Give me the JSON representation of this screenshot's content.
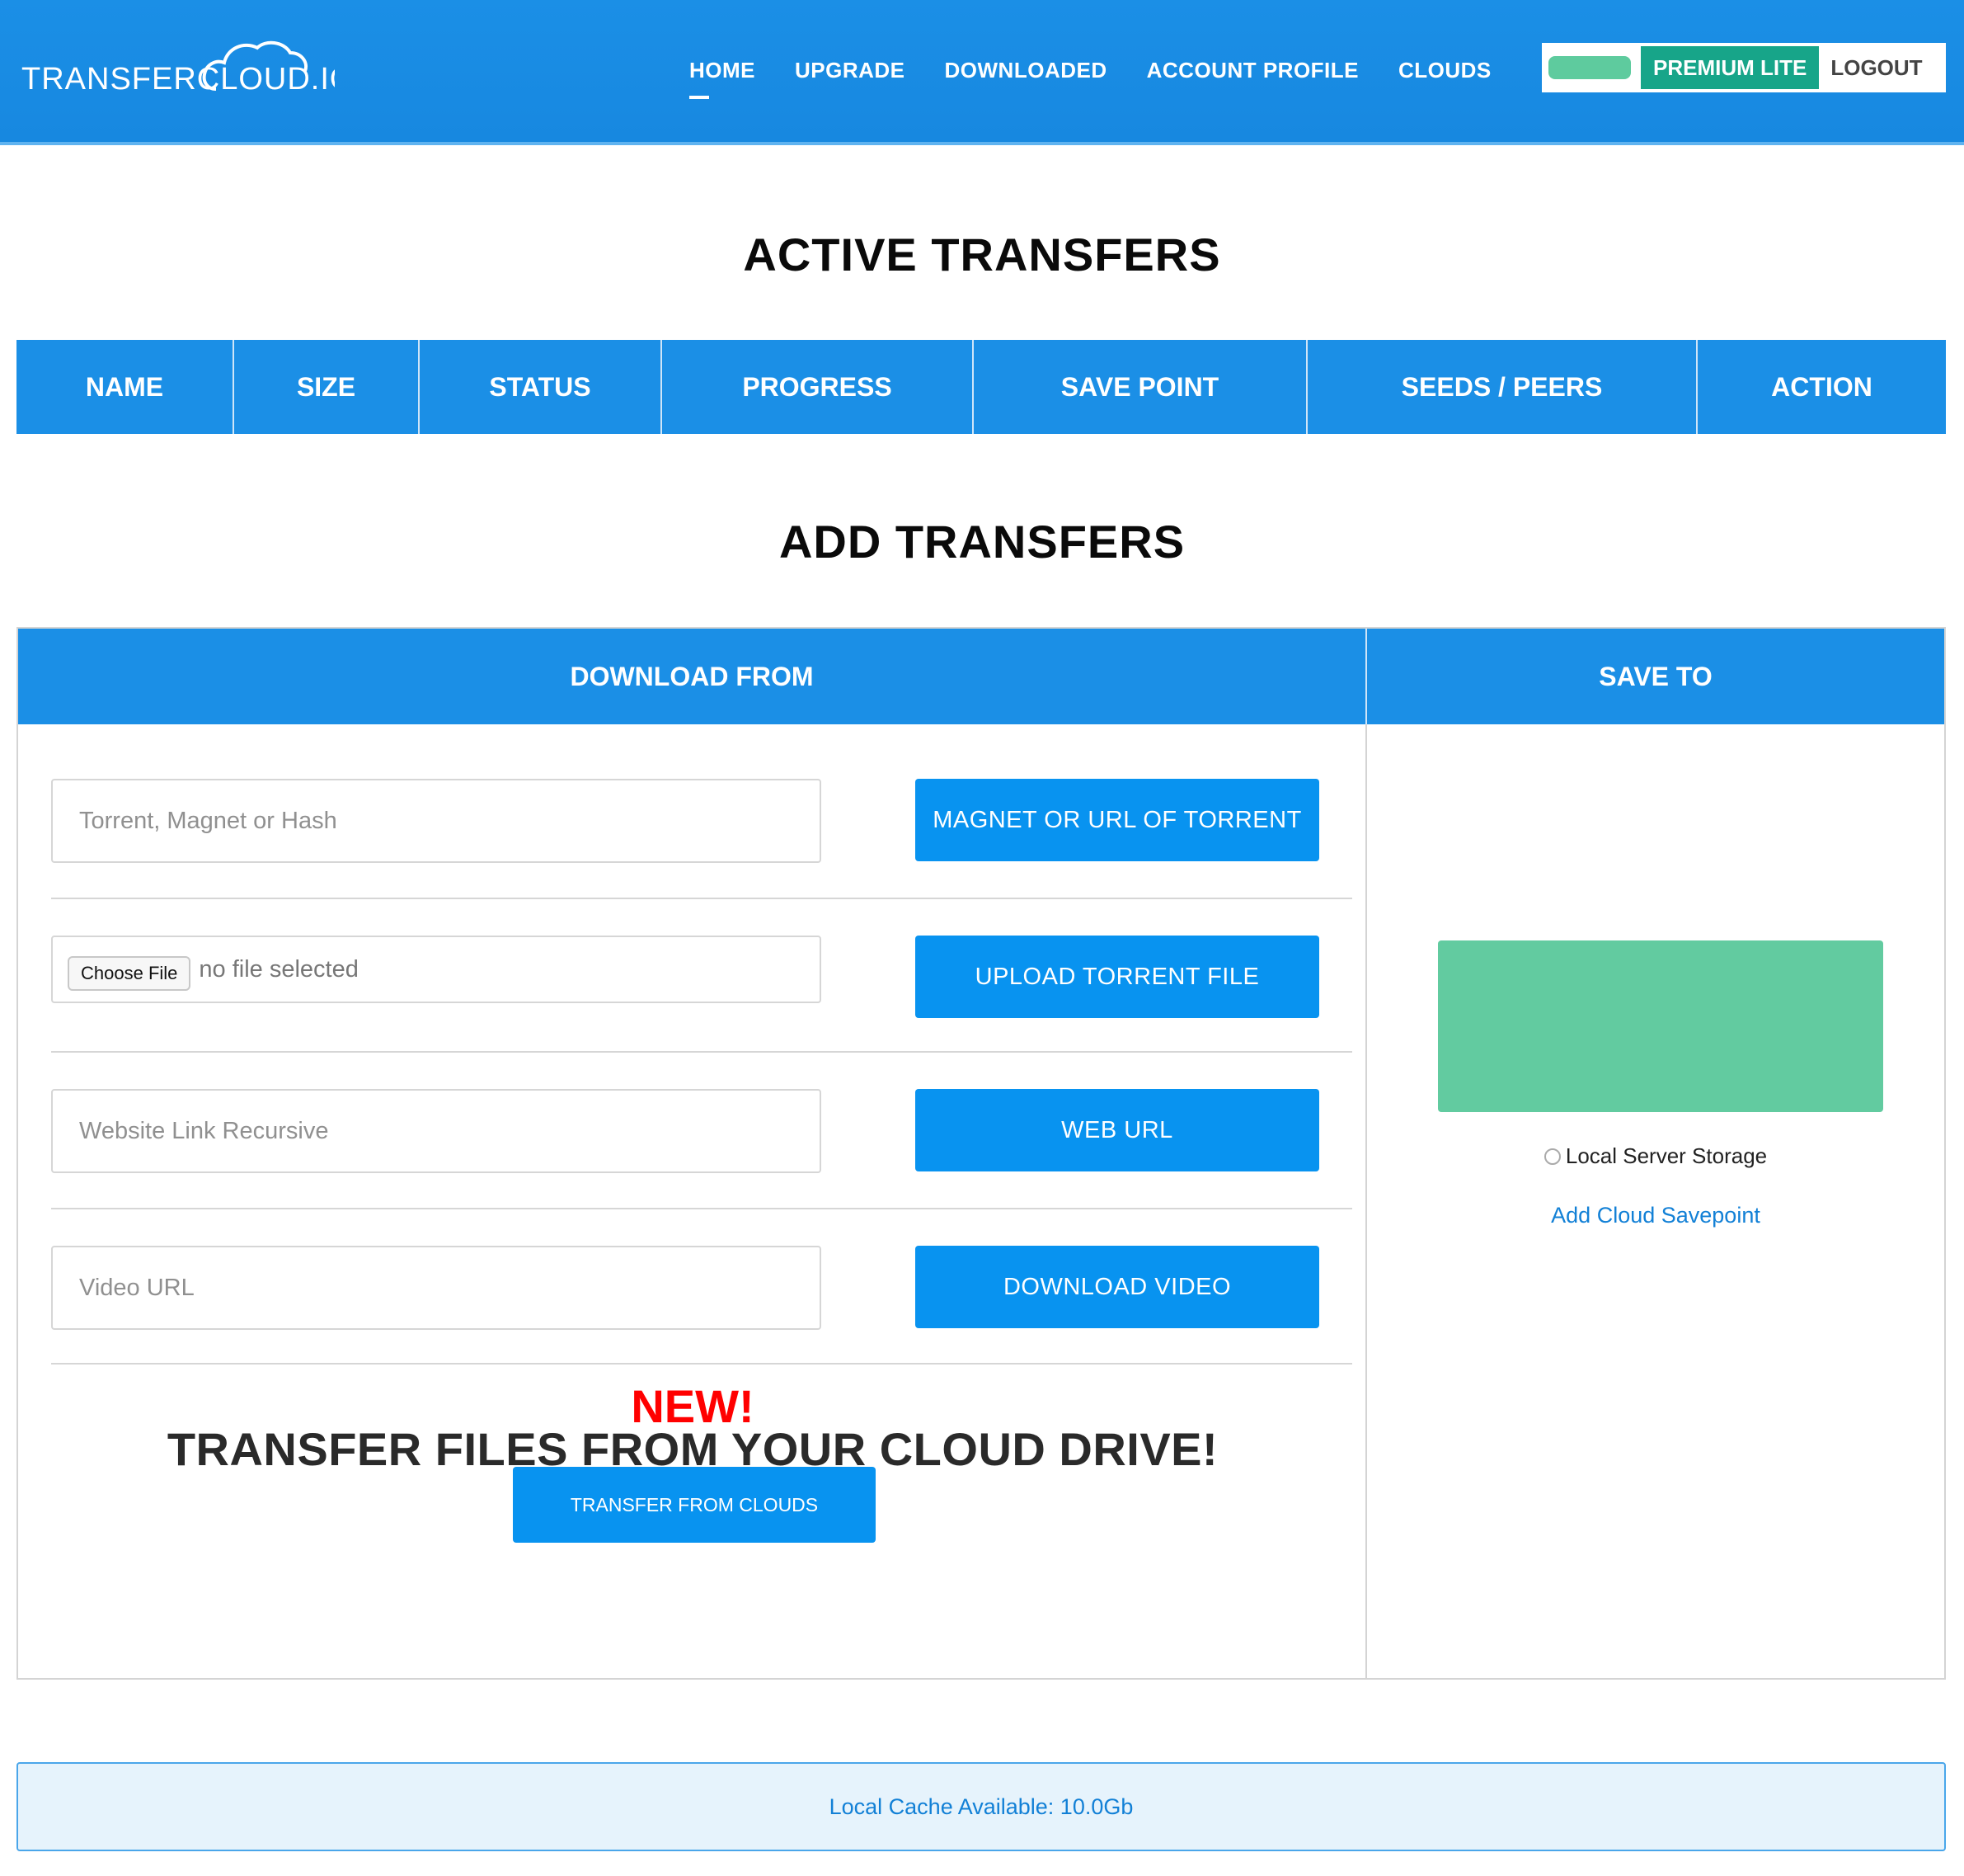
{
  "header": {
    "logo_text": "TRANSFERCLOUD.IO",
    "nav": [
      {
        "label": "HOME",
        "active": true
      },
      {
        "label": "UPGRADE",
        "active": false
      },
      {
        "label": "DOWNLOADED",
        "active": false
      },
      {
        "label": "ACCOUNT PROFILE",
        "active": false
      },
      {
        "label": "CLOUDS",
        "active": false
      }
    ],
    "plan_badge": "PREMIUM LITE",
    "logout_label": "LOGOUT"
  },
  "active_transfers": {
    "title": "ACTIVE TRANSFERS",
    "columns": [
      "NAME",
      "SIZE",
      "STATUS",
      "PROGRESS",
      "SAVE POINT",
      "SEEDS / PEERS",
      "ACTION"
    ]
  },
  "add_transfers": {
    "title": "ADD TRANSFERS",
    "download_from_label": "DOWNLOAD FROM",
    "save_to_label": "SAVE TO",
    "torrent": {
      "placeholder": "Torrent, Magnet or Hash",
      "button": "MAGNET OR URL OF TORRENT"
    },
    "file": {
      "choose_label": "Choose File",
      "status": "no file selected",
      "button": "UPLOAD TORRENT FILE"
    },
    "web": {
      "placeholder": "Website Link Recursive",
      "button": "WEB URL"
    },
    "video": {
      "placeholder": "Video URL",
      "button": "DOWNLOAD VIDEO"
    },
    "promo": {
      "new_label": "NEW!",
      "title": "TRANSFER FILES FROM YOUR CLOUD DRIVE!",
      "button": "TRANSFER FROM CLOUDS"
    },
    "save_to": {
      "local_storage_label": "Local Server Storage",
      "add_cloud_label": "Add Cloud Savepoint"
    }
  },
  "footer": {
    "cache_text": "Local Cache Available: 10.0Gb"
  },
  "colors": {
    "primary": "#1b8fe6",
    "button": "#0893f0",
    "premium": "#17a589",
    "green_block": "#62cba0",
    "new_red": "#ff0000"
  }
}
